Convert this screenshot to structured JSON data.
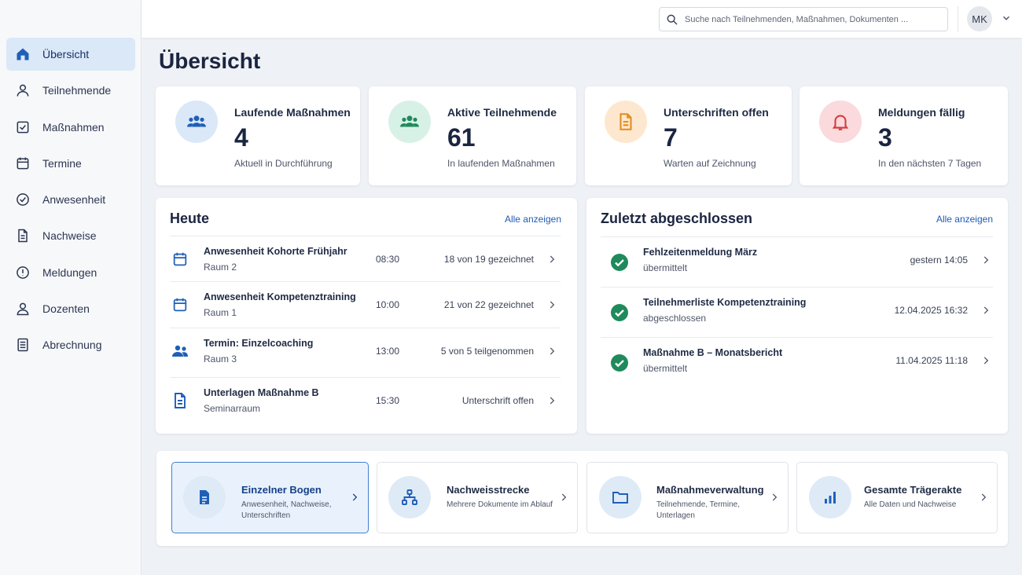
{
  "sidebar": {
    "items": [
      {
        "label": "Übersicht",
        "icon": "home-icon",
        "active": true
      },
      {
        "label": "Teilnehmende",
        "icon": "person-icon"
      },
      {
        "label": "Maßnahmen",
        "icon": "checkbox-icon"
      },
      {
        "label": "Termine",
        "icon": "calendar-icon"
      },
      {
        "label": "Anwesenheit",
        "icon": "check-circle-icon"
      },
      {
        "label": "Nachweise",
        "icon": "document-icon"
      },
      {
        "label": "Meldungen",
        "icon": "alert-icon"
      },
      {
        "label": "Dozenten",
        "icon": "user-icon"
      },
      {
        "label": "Abrechnung",
        "icon": "list-document-icon"
      }
    ]
  },
  "topbar": {
    "search_placeholder": "Suche nach Teilnehmenden, Maßnahmen, Dokumenten ...",
    "avatar_initials": "MK"
  },
  "page": {
    "title": "Übersicht"
  },
  "stats": [
    {
      "label": "Laufende Maßnahmen",
      "value": "4",
      "sub": "Aktuell in Durchführung",
      "icon": "group-icon",
      "bg": "#dbe8f7",
      "fg": "#1f5fb8"
    },
    {
      "label": "Aktive Teilnehmende",
      "value": "61",
      "sub": "In laufenden Maßnahmen",
      "icon": "group-icon",
      "bg": "#d8f1e6",
      "fg": "#1f8a5c"
    },
    {
      "label": "Unterschriften offen",
      "value": "7",
      "sub": "Warten auf Zeichnung",
      "icon": "document-icon",
      "bg": "#fde8cf",
      "fg": "#e58b1b"
    },
    {
      "label": "Meldungen fällig",
      "value": "3",
      "sub": "In den nächsten 7 Tagen",
      "icon": "bell-icon",
      "bg": "#fadadd",
      "fg": "#d63a3a"
    }
  ],
  "today": {
    "title": "Heute",
    "link": "Alle anzeigen",
    "rows": [
      {
        "title": "Anwesenheit Kohorte Frühjahr",
        "sub": "Raum 2",
        "time": "08:30",
        "status": "18 von 19 gezeichnet",
        "icon": "calendar-icon"
      },
      {
        "title": "Anwesenheit Kompetenztraining",
        "sub": "Raum 1",
        "time": "10:00",
        "status": "21 von 22 gezeichnet",
        "icon": "calendar-icon"
      },
      {
        "title": "Termin: Einzelcoaching",
        "sub": "Raum 3",
        "time": "13:00",
        "status": "5 von 5 teilgenommen",
        "icon": "people-icon"
      },
      {
        "title": "Unterlagen Maßnahme B",
        "sub": "Seminarraum",
        "time": "15:30",
        "status": "Unterschrift offen",
        "icon": "document-icon"
      }
    ]
  },
  "recent": {
    "title": "Zuletzt abgeschlossen",
    "link": "Alle anzeigen",
    "rows": [
      {
        "title": "Fehlzeitenmeldung März",
        "sub": "übermittelt",
        "date": "gestern 14:05"
      },
      {
        "title": "Teilnehmerliste Kompetenztraining",
        "sub": "abgeschlossen",
        "date": "12.04.2025 16:32"
      },
      {
        "title": "Maßnahme B – Monatsbericht",
        "sub": "übermittelt",
        "date": "11.04.2025 11:18"
      }
    ]
  },
  "tiles": [
    {
      "title": "Einzelner Bogen",
      "sub": "Anwesenheit, Nachweise, Unterschriften",
      "icon": "document-icon",
      "active": true
    },
    {
      "title": "Nachweisstrecke",
      "sub": "Mehrere Dokumente im Ablauf",
      "icon": "hierarchy-icon"
    },
    {
      "title": "Maßnahmeverwaltung",
      "sub": "Teilnehmende, Termine, Unterlagen",
      "icon": "folder-icon"
    },
    {
      "title": "Gesamte Trägerakte",
      "sub": "Alle Daten und Nachweise",
      "icon": "bar-chart-icon"
    }
  ],
  "colors": {
    "accent": "#1e5cb3",
    "success": "#1f8a5c",
    "nav_active": "#dbe8f7"
  }
}
